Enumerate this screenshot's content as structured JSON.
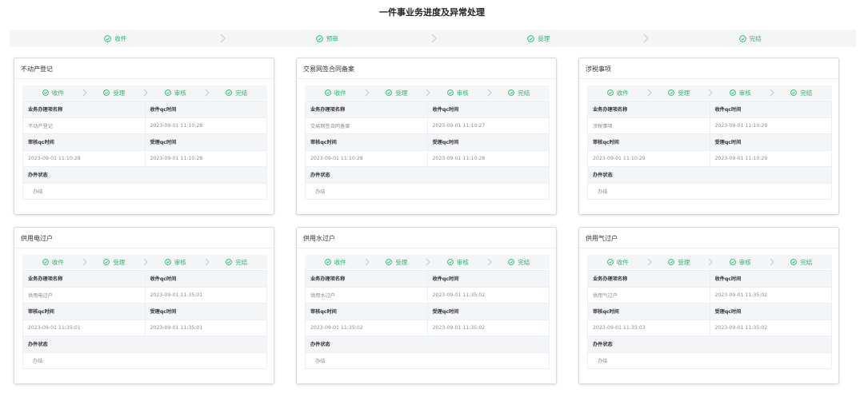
{
  "page": {
    "title": "一件事业务进度及异常处理"
  },
  "top_steps": [
    {
      "label": "收件"
    },
    {
      "label": "预审"
    },
    {
      "label": "受理"
    },
    {
      "label": "完结"
    }
  ],
  "colors": {
    "success": "#19be6b",
    "header_bg": "#f4f5f7",
    "border": "#ebeef5"
  },
  "icons": {
    "step_done": "check-circle-icon",
    "separator": "chevron-right-icon"
  },
  "labels": {
    "item_name": "业务办理项名称",
    "receive_time": "收件qc时间",
    "review_time": "审核qc时间",
    "accept_time": "受理qc时间",
    "status": "办件状态"
  },
  "cards": [
    {
      "title": "不动产登记",
      "steps": [
        {
          "label": "收件"
        },
        {
          "label": "受理"
        },
        {
          "label": "审核"
        },
        {
          "label": "完结"
        }
      ],
      "item_name": "不动产登记",
      "receive_time": "2023-09-01 11:10:28",
      "review_time": "2023-09-01 11:10:28",
      "accept_time": "2023-09-01 11:10:28",
      "status": "办结"
    },
    {
      "title": "交易网签合同备案",
      "steps": [
        {
          "label": "收件"
        },
        {
          "label": "受理"
        },
        {
          "label": "审核"
        },
        {
          "label": "完结"
        }
      ],
      "item_name": "交易网签合同备案",
      "receive_time": "2023-09-01 11:10:27",
      "review_time": "2023-09-01 11:10:28",
      "accept_time": "2023-09-01 11:10:28",
      "status": "办结"
    },
    {
      "title": "涉税事项",
      "steps": [
        {
          "label": "收件"
        },
        {
          "label": "受理"
        },
        {
          "label": "审核"
        },
        {
          "label": "完结"
        }
      ],
      "item_name": "涉税事项",
      "receive_time": "2023-09-01 11:10:29",
      "review_time": "2023-09-01 11:10:29",
      "accept_time": "2023-09-01 11:10:29",
      "status": "办结"
    },
    {
      "title": "供用电过户",
      "steps": [
        {
          "label": "收件"
        },
        {
          "label": "受理"
        },
        {
          "label": "审核"
        },
        {
          "label": "完结"
        }
      ],
      "item_name": "供用电过户",
      "receive_time": "2023-09-01 11:35:01",
      "review_time": "2023-09-01 11:35:01",
      "accept_time": "2023-09-01 11:35:01",
      "status": "办结"
    },
    {
      "title": "供用水过户",
      "steps": [
        {
          "label": "收件"
        },
        {
          "label": "受理"
        },
        {
          "label": "审核"
        },
        {
          "label": "完结"
        }
      ],
      "item_name": "供用水过户",
      "receive_time": "2023-09-01 11:35:02",
      "review_time": "2023-09-01 11:35:02",
      "accept_time": "2023-09-01 11:35:02",
      "status": "办结"
    },
    {
      "title": "供用气过户",
      "steps": [
        {
          "label": "收件"
        },
        {
          "label": "受理"
        },
        {
          "label": "审核"
        },
        {
          "label": "完结"
        }
      ],
      "item_name": "供用气过户",
      "receive_time": "2023-09-01 11:35:02",
      "review_time": "2023-09-01 11:35:03",
      "accept_time": "2023-09-01 11:35:02",
      "status": "办结"
    }
  ]
}
